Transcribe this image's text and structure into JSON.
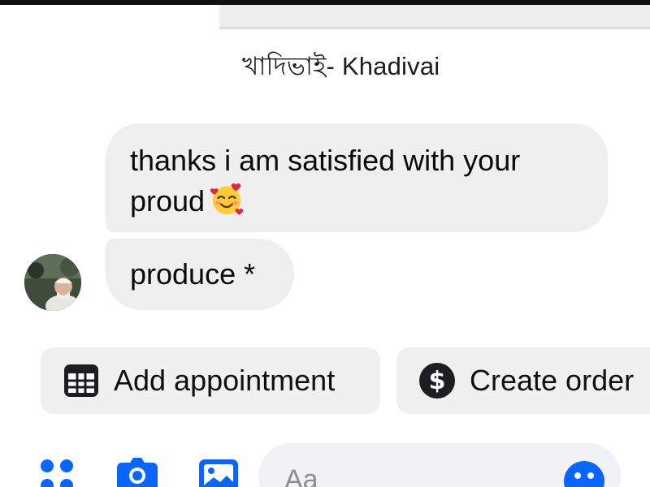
{
  "header": {
    "sender_name": "খাদিভাই- Khadivai"
  },
  "messages": [
    {
      "text": "thanks i am satisfied with your",
      "text_line2": "proud",
      "emoji": "smiling-face-with-hearts"
    },
    {
      "text": "produce *"
    }
  ],
  "quick_actions": [
    {
      "label": "Add appointment",
      "icon": "calendar-icon"
    },
    {
      "label": "Create order",
      "icon": "dollar-icon"
    }
  ],
  "composer": {
    "placeholder": "Aa",
    "icons": [
      "apps-icon",
      "camera-icon",
      "gallery-icon",
      "emoji-icon"
    ]
  },
  "colors": {
    "accent": "#0866ff",
    "bubble": "#efefef",
    "chip": "#f0f0f0"
  }
}
